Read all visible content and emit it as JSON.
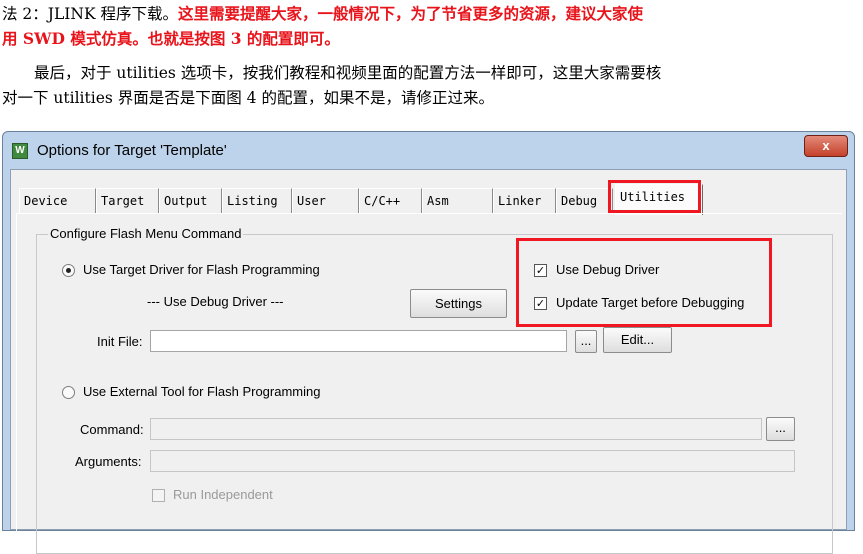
{
  "document": {
    "line1_prefix": "法 2：JLINK 程序下载。",
    "line1_red": "这里需要提醒大家，一般情况下，为了节省更多的资源，建议大家使",
    "line2_red": "用 SWD 模式仿真。也就是按图 3 的配置即可。",
    "line3": "最后，对于 utilities 选项卡，按我们教程和视频里面的配置方法一样即可，这里大家需要核",
    "line4": "对一下 utilities 界面是否是下面图 4 的配置，如果不是，请修正过来。"
  },
  "colors": {
    "highlight": "#ef1721",
    "emphasis_text": "#e8141b"
  },
  "window": {
    "title": "Options for Target 'Template'",
    "icon": "uvision-app-icon",
    "close_label": "x"
  },
  "tabs": [
    "Device",
    "Target",
    "Output",
    "Listing",
    "User",
    "C/C++",
    "Asm",
    "Linker",
    "Debug",
    "Utilities"
  ],
  "active_tab": "Utilities",
  "flash_group": {
    "title": "Configure Flash Menu Command",
    "use_target_driver_label": "Use Target Driver for Flash Programming",
    "use_target_driver_selected": true,
    "driver_display": "--- Use Debug Driver ---",
    "settings_label": "Settings",
    "use_debug_driver_label": "Use Debug Driver",
    "use_debug_driver_checked": true,
    "update_target_label": "Update Target before Debugging",
    "update_target_checked": true,
    "init_file_label": "Init File:",
    "init_file_value": "",
    "browse_label": "...",
    "edit_label": "Edit...",
    "use_external_tool_label": "Use External Tool for Flash Programming",
    "use_external_tool_selected": false,
    "command_label": "Command:",
    "command_value": "",
    "arguments_label": "Arguments:",
    "arguments_value": "",
    "run_independent_label": "Run Independent",
    "run_independent_checked": false
  }
}
